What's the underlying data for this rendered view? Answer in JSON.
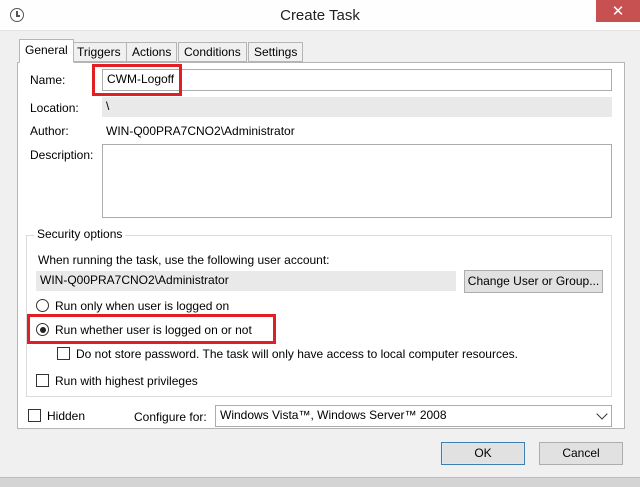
{
  "window": {
    "title": "Create Task",
    "close_glyph": "✕",
    "icon": "clock-icon"
  },
  "tabs": [
    {
      "label": "General",
      "active": true
    },
    {
      "label": "Triggers",
      "active": false
    },
    {
      "label": "Actions",
      "active": false
    },
    {
      "label": "Conditions",
      "active": false
    },
    {
      "label": "Settings",
      "active": false
    }
  ],
  "general": {
    "name_label": "Name:",
    "name_value": "CWM-Logoff",
    "location_label": "Location:",
    "location_value": "\\",
    "author_label": "Author:",
    "author_value": "WIN-Q00PRA7CNO2\\Administrator",
    "description_label": "Description:",
    "description_value": ""
  },
  "security": {
    "legend": "Security options",
    "account_prompt": "When running the task, use the following user account:",
    "account_value": "WIN-Q00PRA7CNO2\\Administrator",
    "change_button": "Change User or Group...",
    "radio_logged_on": "Run only when user is logged on",
    "radio_whether": "Run whether user is logged on or not",
    "selected_radio": "radio_whether",
    "no_store_password": "Do not store password.  The task will only have access to local computer resources.",
    "highest_privileges": "Run with highest privileges"
  },
  "footer": {
    "hidden_label": "Hidden",
    "configure_label": "Configure for:",
    "configure_value": "Windows Vista™, Windows Server™ 2008",
    "ok_button": "OK",
    "cancel_button": "Cancel"
  },
  "colors": {
    "annotation_red": "#e01e24",
    "close_red": "#c75050"
  }
}
